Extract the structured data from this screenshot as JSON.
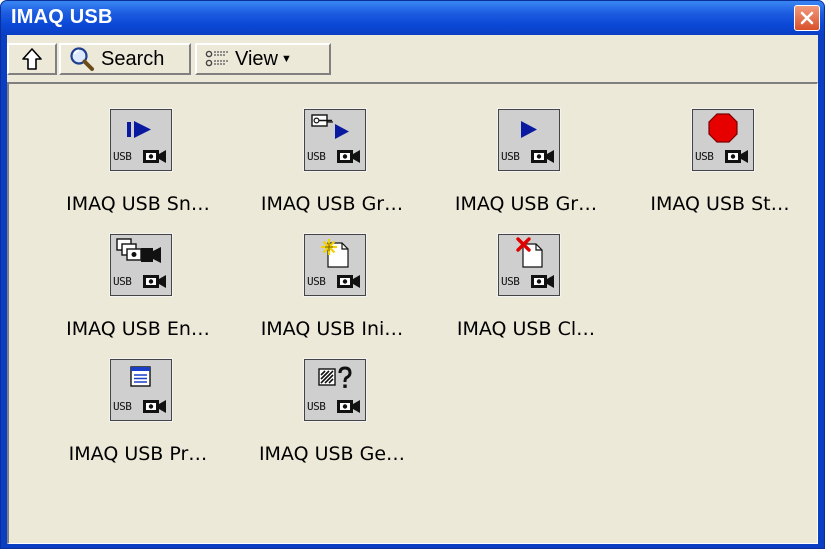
{
  "window": {
    "title": "IMAQ USB"
  },
  "toolbar": {
    "search_label": "Search",
    "view_label": "View"
  },
  "palette": {
    "icon_caption": "USB",
    "items": [
      {
        "label": "IMAQ USB Sn…",
        "icon": "snap-arrow-icon"
      },
      {
        "label": "IMAQ USB Gr…",
        "icon": "grab-setup-icon"
      },
      {
        "label": "IMAQ USB Gr…",
        "icon": "grab-acquire-icon"
      },
      {
        "label": "IMAQ USB St…",
        "icon": "stop-sign-icon"
      },
      {
        "label": "IMAQ USB En…",
        "icon": "enumerate-cameras-icon"
      },
      {
        "label": "IMAQ USB Ini…",
        "icon": "init-new-icon"
      },
      {
        "label": "IMAQ USB Cl…",
        "icon": "close-x-icon"
      },
      {
        "label": "IMAQ USB Pr…",
        "icon": "property-page-icon"
      },
      {
        "label": "IMAQ USB Ge…",
        "icon": "get-info-icon"
      }
    ]
  },
  "colors": {
    "title_bar": "#0a48d6",
    "close_button": "#d9502a",
    "client_bg": "#ece9d8",
    "stop_red": "#e60000",
    "arrow_navy": "#0a1aa0"
  }
}
